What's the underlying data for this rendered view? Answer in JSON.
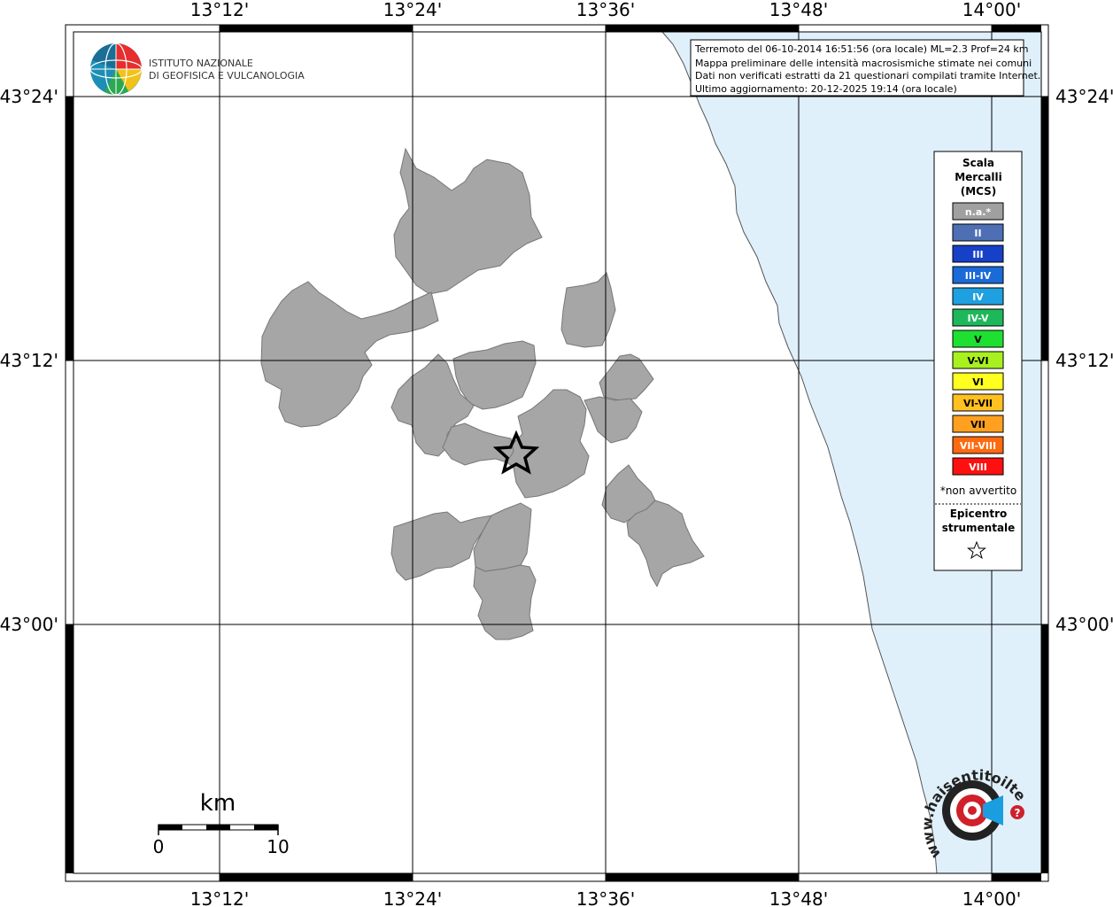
{
  "institute": {
    "line1": "ISTITUTO NAZIONALE",
    "line2": "DI GEOFISICA E VULCANOLOGIA"
  },
  "info": {
    "line1": "Terremoto del 06-10-2014 16:51:56 (ora locale) ML=2.3 Prof=24 km",
    "line2": "Mappa preliminare delle intensità macrosismiche stimate nei comuni",
    "line3": "Dati non verificati estratti da 21 questionari compilati tramite Internet.",
    "line4": "Ultimo aggiornamento: 20-12-2025 19:14 (ora locale)"
  },
  "axes": {
    "lon": [
      "13°12'",
      "13°24'",
      "13°36'",
      "13°48'",
      "14°00'"
    ],
    "lat": [
      "43°24'",
      "43°12'",
      "43°00'"
    ]
  },
  "legend": {
    "title1": "Scala",
    "title2": "Mercalli",
    "title3": "(MCS)",
    "classes": [
      {
        "label": "n.a.*",
        "color": "#a0a0a0"
      },
      {
        "label": "II",
        "color": "#4f6fb5"
      },
      {
        "label": "III",
        "color": "#1740c8"
      },
      {
        "label": "III-IV",
        "color": "#1a6ad8"
      },
      {
        "label": "IV",
        "color": "#1fa0e0"
      },
      {
        "label": "IV-V",
        "color": "#1eb85a"
      },
      {
        "label": "V",
        "color": "#1ee030"
      },
      {
        "label": "V-VI",
        "color": "#a8f020"
      },
      {
        "label": "VI",
        "color": "#ffff20"
      },
      {
        "label": "VI-VII",
        "color": "#ffc020"
      },
      {
        "label": "VII",
        "color": "#ffa020"
      },
      {
        "label": "VII-VIII",
        "color": "#ff6a10"
      },
      {
        "label": "VIII",
        "color": "#ff1010"
      }
    ],
    "note": "*non avvertito",
    "epicenter1": "Epicentro",
    "epicenter2": "strumentale"
  },
  "scalebar": {
    "unit": "km",
    "min": "0",
    "max": "10"
  },
  "site_logo": {
    "text": "www.haisentitoilterremoto.it",
    "mark": "?"
  },
  "colors": {
    "sea": "#dff0fb",
    "municipality": "#a6a6a6",
    "grid": "#000000"
  }
}
